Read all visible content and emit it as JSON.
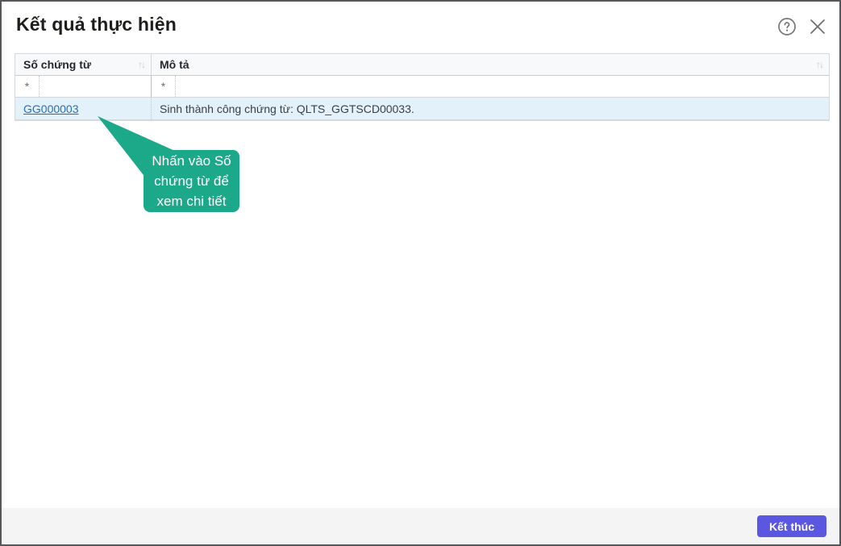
{
  "dialog": {
    "title": "Kết quả thực hiện"
  },
  "icons": {
    "sort": "↑↓",
    "help": "circle-question",
    "close": "x-mark"
  },
  "table": {
    "columns": [
      {
        "label": "Số chứng từ"
      },
      {
        "label": "Mô tả"
      }
    ],
    "filter": {
      "operator": "*",
      "col1_value": "",
      "col2_value": ""
    },
    "rows": [
      {
        "so_chung_tu": "GG000003",
        "mo_ta": "Sinh thành công chứng từ: QLTS_GGTSCD00033."
      }
    ]
  },
  "callout": {
    "text": "Nhấn vào Số chứng từ để xem chi tiết",
    "color": "#1ba98a"
  },
  "footer": {
    "finish_label": "Kết thúc",
    "button_color": "#5b57e1"
  },
  "colors": {
    "link": "#2a6eb0",
    "row_highlight": "#e3f1fb",
    "footer_bg": "#f4f4f4",
    "border": "#56575b"
  }
}
